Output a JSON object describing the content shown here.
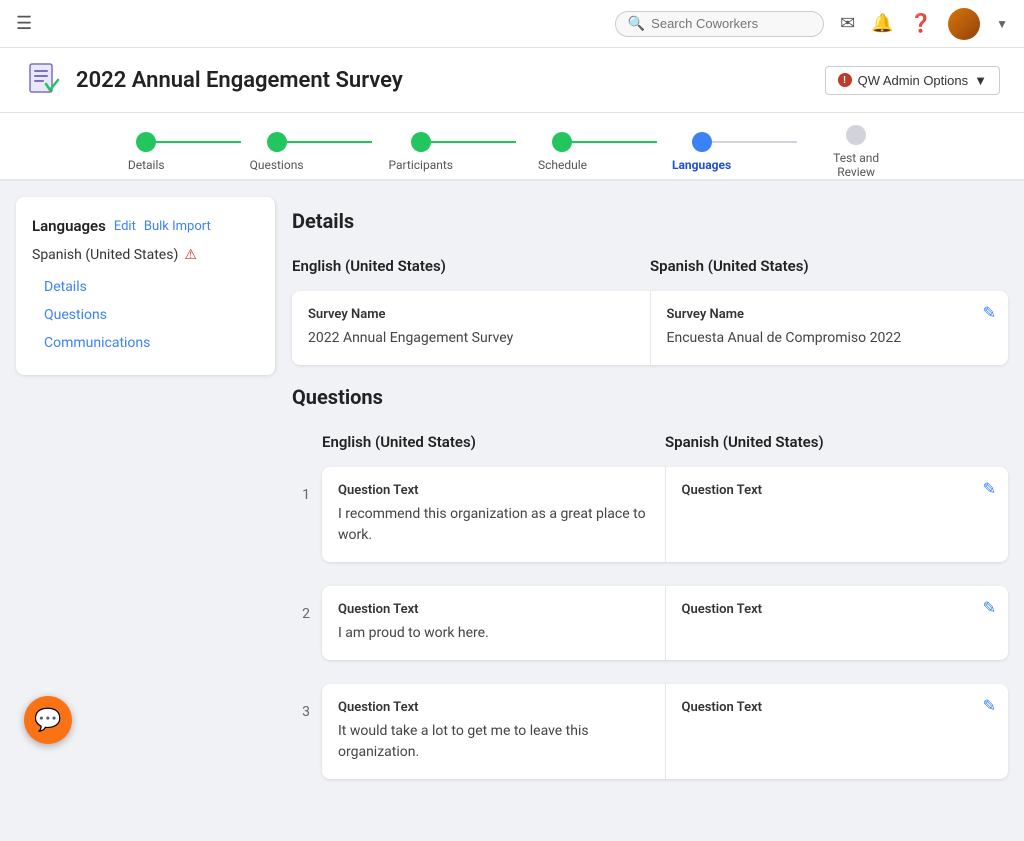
{
  "topNav": {
    "search_placeholder": "Search Coworkers"
  },
  "pageHeader": {
    "title": "2022 Annual Engagement Survey",
    "admin_btn_label": "QW Admin Options"
  },
  "stepper": {
    "steps": [
      {
        "label": "Details",
        "state": "complete"
      },
      {
        "label": "Questions",
        "state": "complete"
      },
      {
        "label": "Participants",
        "state": "complete"
      },
      {
        "label": "Schedule",
        "state": "complete"
      },
      {
        "label": "Languages",
        "state": "active"
      },
      {
        "label": "Test and Review",
        "state": "inactive"
      }
    ]
  },
  "sidebar": {
    "title": "Languages",
    "edit_label": "Edit",
    "bulk_import_label": "Bulk Import",
    "language_item": "Spanish (United States)",
    "nav_items": [
      {
        "label": "Details"
      },
      {
        "label": "Questions"
      },
      {
        "label": "Communications"
      }
    ]
  },
  "details_section": {
    "title": "Details",
    "col1_header": "English (United States)",
    "col2_header": "Spanish (United States)",
    "survey_name_label": "Survey Name",
    "survey_name_en": "2022 Annual Engagement Survey",
    "survey_name_es": "Encuesta Anual de Compromiso 2022"
  },
  "questions_section": {
    "title": "Questions",
    "col1_header": "English (United States)",
    "col2_header": "Spanish (United States)",
    "question_label": "Question Text",
    "questions": [
      {
        "number": "1",
        "text_en": "I recommend this organization as a great place to work.",
        "text_es": ""
      },
      {
        "number": "2",
        "text_en": "I am proud to work here.",
        "text_es": ""
      },
      {
        "number": "3",
        "text_en": "It would take a lot to get me to leave this organization.",
        "text_es": ""
      }
    ]
  }
}
